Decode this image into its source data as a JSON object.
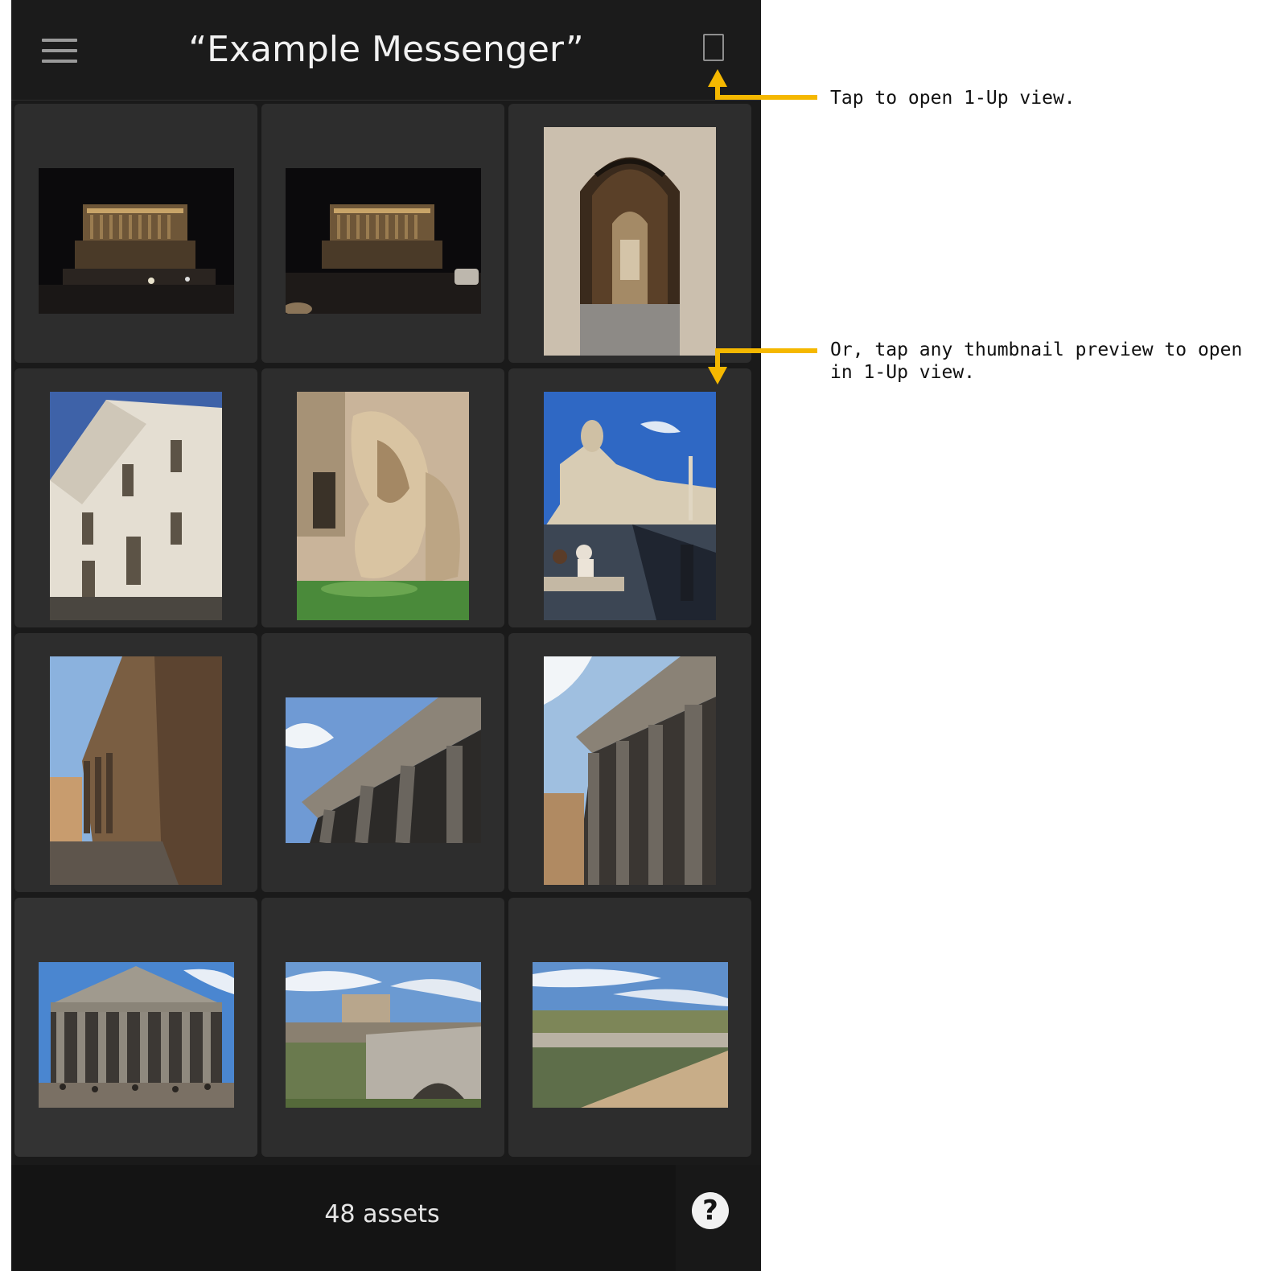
{
  "header": {
    "title": "“Example Messenger”",
    "menu_icon": "hamburger-icon",
    "oneup_icon": "single-page-icon"
  },
  "thumbnails": [
    {
      "label": "Vittoriano at night",
      "orientation": "landscape"
    },
    {
      "label": "Vittoriano at night 2",
      "orientation": "landscape"
    },
    {
      "label": "Arched doorway",
      "orientation": "portrait"
    },
    {
      "label": "Church facade",
      "orientation": "portrait"
    },
    {
      "label": "Fountain statue",
      "orientation": "portrait"
    },
    {
      "label": "Piazza Navona",
      "orientation": "portrait"
    },
    {
      "label": "Pantheon side wall",
      "orientation": "portrait"
    },
    {
      "label": "Pantheon portico",
      "orientation": "landscape"
    },
    {
      "label": "Pantheon columns",
      "orientation": "portrait"
    },
    {
      "label": "Pantheon front",
      "orientation": "landscape"
    },
    {
      "label": "Castel Sant'Angelo bridge",
      "orientation": "landscape"
    },
    {
      "label": "Tiber river",
      "orientation": "landscape"
    }
  ],
  "footer": {
    "asset_count": "48 assets",
    "help_label": "?"
  },
  "annotations": {
    "oneup": "Tap to open 1-Up view.",
    "thumbnail_line1": "Or, tap any thumbnail preview to open",
    "thumbnail_line2": "in 1-Up view.",
    "arrow_color": "#f5b800"
  },
  "colors": {
    "phone_bg": "#1a1a1a",
    "cell_bg": "#2d2d2d",
    "accent": "#f5b800"
  }
}
